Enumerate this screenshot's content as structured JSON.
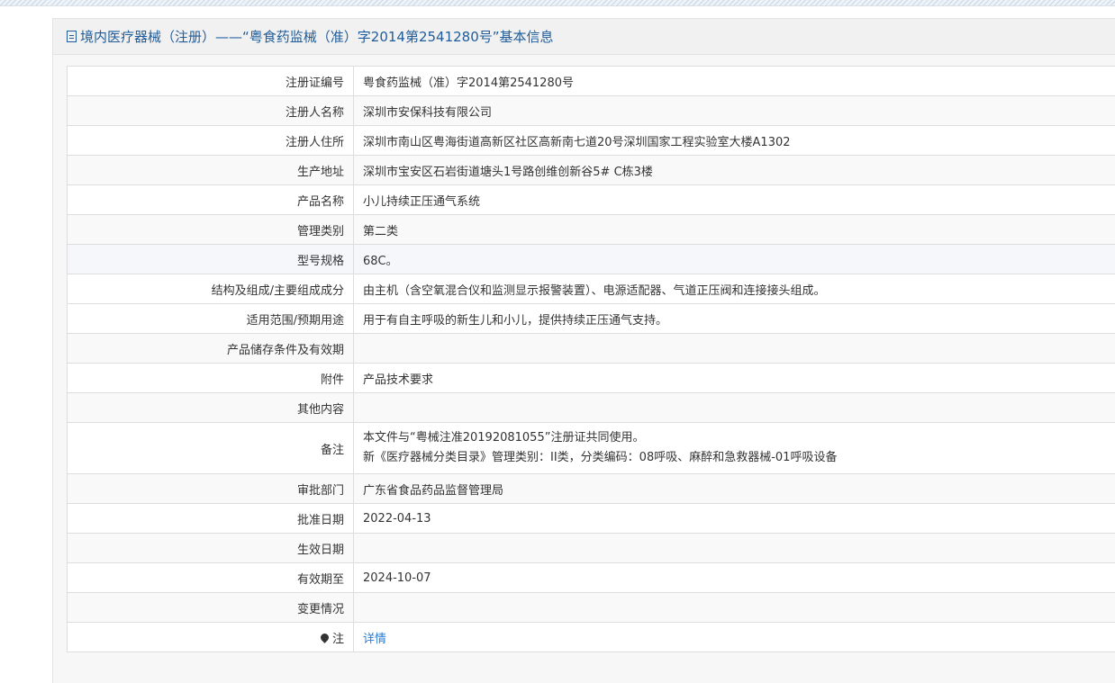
{
  "header": {
    "title": "境内医疗器械（注册）——“粤食药监械（准）字2014第2541280号”基本信息"
  },
  "rows": [
    {
      "label": "注册证编号",
      "value": "粤食药监械（准）字2014第2541280号"
    },
    {
      "label": "注册人名称",
      "value": "深圳市安保科技有限公司"
    },
    {
      "label": "注册人住所",
      "value": "深圳市南山区粤海街道高新区社区高新南七道20号深圳国家工程实验室大楼A1302"
    },
    {
      "label": "生产地址",
      "value": "深圳市宝安区石岩街道塘头1号路创维创新谷5# C栋3楼"
    },
    {
      "label": "产品名称",
      "value": "小儿持续正压通气系统"
    },
    {
      "label": "管理类别",
      "value": "第二类"
    },
    {
      "label": "型号规格",
      "value": "68C。"
    },
    {
      "label": "结构及组成/主要组成成分",
      "value": "由主机（含空氧混合仪和监测显示报警装置）、电源适配器、气道正压阀和连接接头组成。"
    },
    {
      "label": "适用范围/预期用途",
      "value": "用于有自主呼吸的新生儿和小儿，提供持续正压通气支持。"
    },
    {
      "label": "产品储存条件及有效期",
      "value": ""
    },
    {
      "label": "附件",
      "value": "产品技术要求"
    },
    {
      "label": "其他内容",
      "value": ""
    },
    {
      "label": "备注",
      "line1": "本文件与“粤械注准20192081055”注册证共同使用。",
      "line2": "新《医疗器械分类目录》管理类别：II类，分类编码：08呼吸、麻醉和急救器械-01呼吸设备"
    },
    {
      "label": "审批部门",
      "value": "广东省食品药品监督管理局"
    },
    {
      "label": "批准日期",
      "value": "2022-04-13"
    },
    {
      "label": "生效日期",
      "value": ""
    },
    {
      "label": "有效期至",
      "value": "2024-10-07"
    },
    {
      "label": "变更情况",
      "value": ""
    },
    {
      "label": "注",
      "value": "详情",
      "icon": "pin-icon"
    }
  ]
}
